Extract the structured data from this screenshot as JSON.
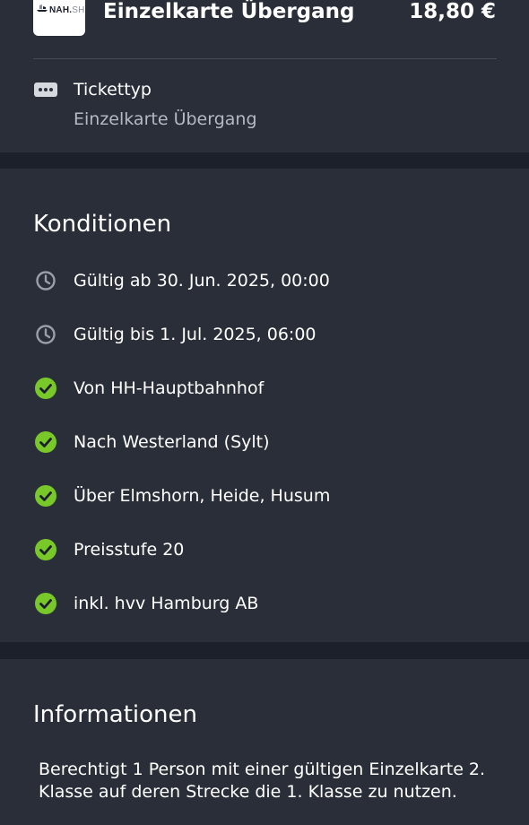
{
  "ticket": {
    "logo_text_bold": "NAH.",
    "logo_text_light": "SH",
    "title": "Einzelkarte Übergang",
    "price": "18,80 €",
    "type_label": "Tickettyp",
    "type_value": "Einzelkarte Übergang"
  },
  "conditions": {
    "title": "Konditionen",
    "items": [
      {
        "icon": "clock-icon",
        "text": "Gültig ab 30. Jun. 2025, 00:00"
      },
      {
        "icon": "clock-icon",
        "text": "Gültig bis 1. Jul. 2025, 06:00"
      },
      {
        "icon": "check-circle-icon",
        "text": "Von HH-Hauptbahnhof"
      },
      {
        "icon": "check-circle-icon",
        "text": "Nach Westerland (Sylt)"
      },
      {
        "icon": "check-circle-icon",
        "text": "Über Elmshorn, Heide, Husum"
      },
      {
        "icon": "check-circle-icon",
        "text": "Preisstufe 20"
      },
      {
        "icon": "check-circle-icon",
        "text": "inkl. hvv Hamburg AB"
      }
    ]
  },
  "information": {
    "title": "Informationen",
    "text": "Berechtigt 1 Person mit einer gültigen Einzelkarte 2. Klasse auf deren Strecke die 1. Klasse zu nutzen."
  },
  "colors": {
    "background": "#1c202a",
    "card": "#2a2e38",
    "check_green": "#78c829",
    "clock_grey": "#9a9ea6"
  }
}
